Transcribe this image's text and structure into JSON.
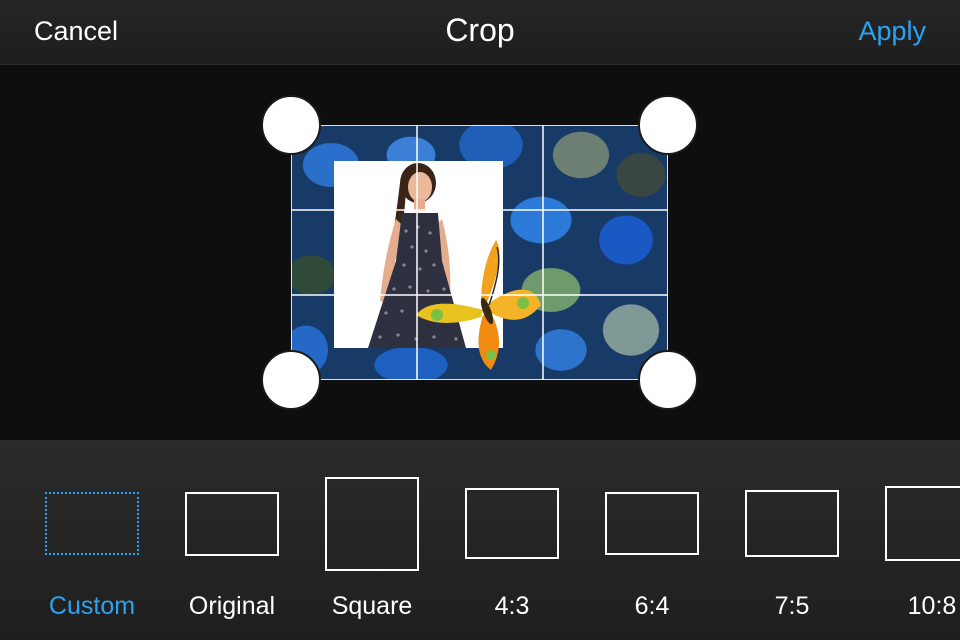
{
  "header": {
    "cancel_label": "Cancel",
    "title": "Crop",
    "apply_label": "Apply"
  },
  "colors": {
    "accent": "#2aa3f0",
    "toolbar_bg": "#232323",
    "canvas_bg": "#0e0e0e"
  },
  "editor": {
    "image_description_icon": "photo-collage",
    "grid": "rule-of-thirds"
  },
  "ratios": {
    "selected": "Custom",
    "items": [
      {
        "label": "Custom"
      },
      {
        "label": "Original"
      },
      {
        "label": "Square"
      },
      {
        "label": "4:3"
      },
      {
        "label": "6:4"
      },
      {
        "label": "7:5"
      },
      {
        "label": "10:8"
      }
    ]
  }
}
